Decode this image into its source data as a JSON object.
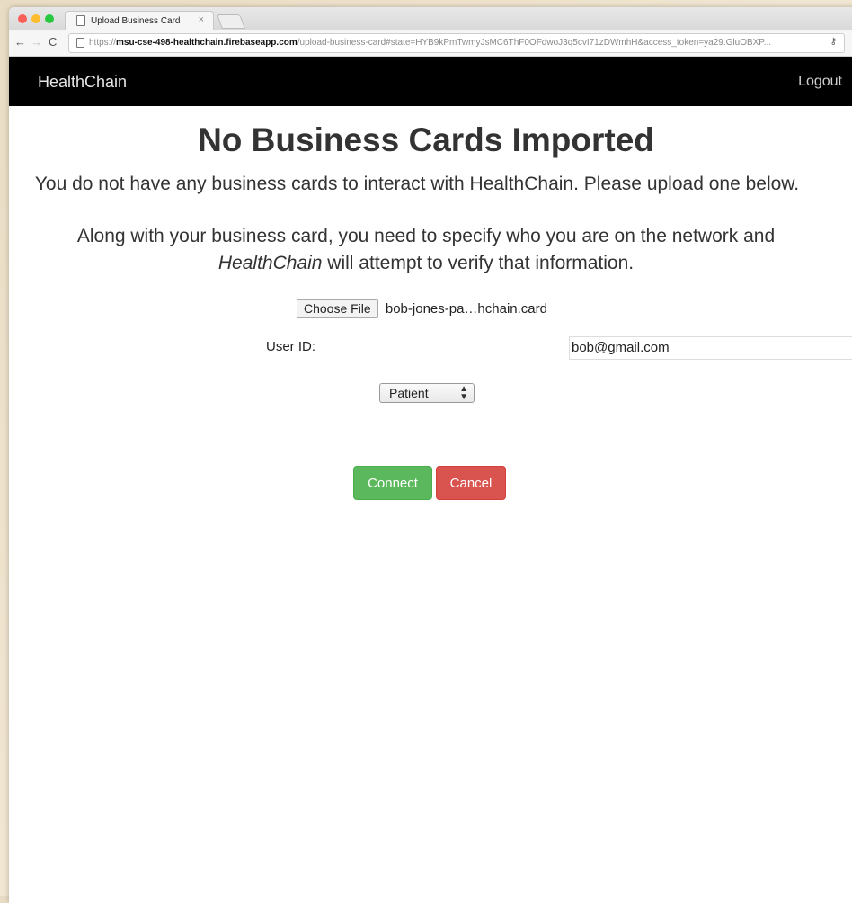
{
  "browser": {
    "tab_title": "Upload Business Card",
    "tab_close": "×",
    "url_scheme": "https://",
    "url_host": "msu-cse-498-healthchain.firebaseapp.com",
    "url_path": "/upload-business-card#state=HYB9kPmTwmyJsMC6ThF0OFdwoJ3q5cvI71zDWmhH&access_token=ya29.GluOBXP...",
    "back": "←",
    "forward": "→",
    "reload": "C",
    "key_glyph": "⚷"
  },
  "navbar": {
    "brand": "HealthChain",
    "logout": "Logout"
  },
  "main": {
    "heading": "No Business Cards Imported",
    "subtitle": "You do not have any business cards to interact with HealthChain. Please upload one below.",
    "explain_pre": "Along with your business card, you need to specify who you are on the network and",
    "explain_em": "HealthChain",
    "explain_post": " will attempt to verify that information."
  },
  "form": {
    "choose_file_label": "Choose File",
    "chosen_file": "bob-jones-pa…hchain.card",
    "user_id_label": "User ID:",
    "user_id_value": "bob@gmail.com",
    "role_selected": "Patient",
    "connect_label": "Connect",
    "cancel_label": "Cancel"
  },
  "colors": {
    "navbar_bg": "#000000",
    "connect": "#5cb85c",
    "cancel": "#d9534f"
  }
}
